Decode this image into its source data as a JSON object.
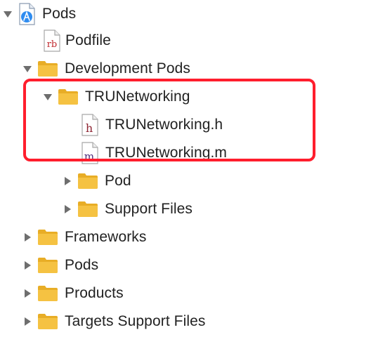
{
  "project_navigator": {
    "items": [
      {
        "label": "Pods",
        "icon": "xcode-project-icon",
        "expanded": true
      },
      {
        "label": "Podfile",
        "icon": "ruby-file-icon",
        "icon_text": "rb"
      },
      {
        "label": "Development Pods",
        "icon": "folder-icon",
        "expanded": true
      },
      {
        "label": "TRUNetworking",
        "icon": "folder-icon",
        "expanded": true
      },
      {
        "label": "TRUNetworking.h",
        "icon": "header-file-icon",
        "icon_text": "h"
      },
      {
        "label": "TRUNetworking.m",
        "icon": "objc-source-file-icon",
        "icon_text": "m"
      },
      {
        "label": "Pod",
        "icon": "folder-icon",
        "expanded": false
      },
      {
        "label": "Support Files",
        "icon": "folder-icon",
        "expanded": false
      },
      {
        "label": "Frameworks",
        "icon": "folder-icon",
        "expanded": false
      },
      {
        "label": "Pods",
        "icon": "folder-icon",
        "expanded": false
      },
      {
        "label": "Products",
        "icon": "folder-icon",
        "expanded": false
      },
      {
        "label": "Targets Support Files",
        "icon": "folder-icon",
        "expanded": false
      }
    ]
  },
  "colors": {
    "folder": "#f5c242",
    "highlight": "#ff1e2d",
    "disclosure": "#6e6e6e",
    "ruby": "#c0282d",
    "header": "#8e2432",
    "source": "#4b2a7a"
  }
}
